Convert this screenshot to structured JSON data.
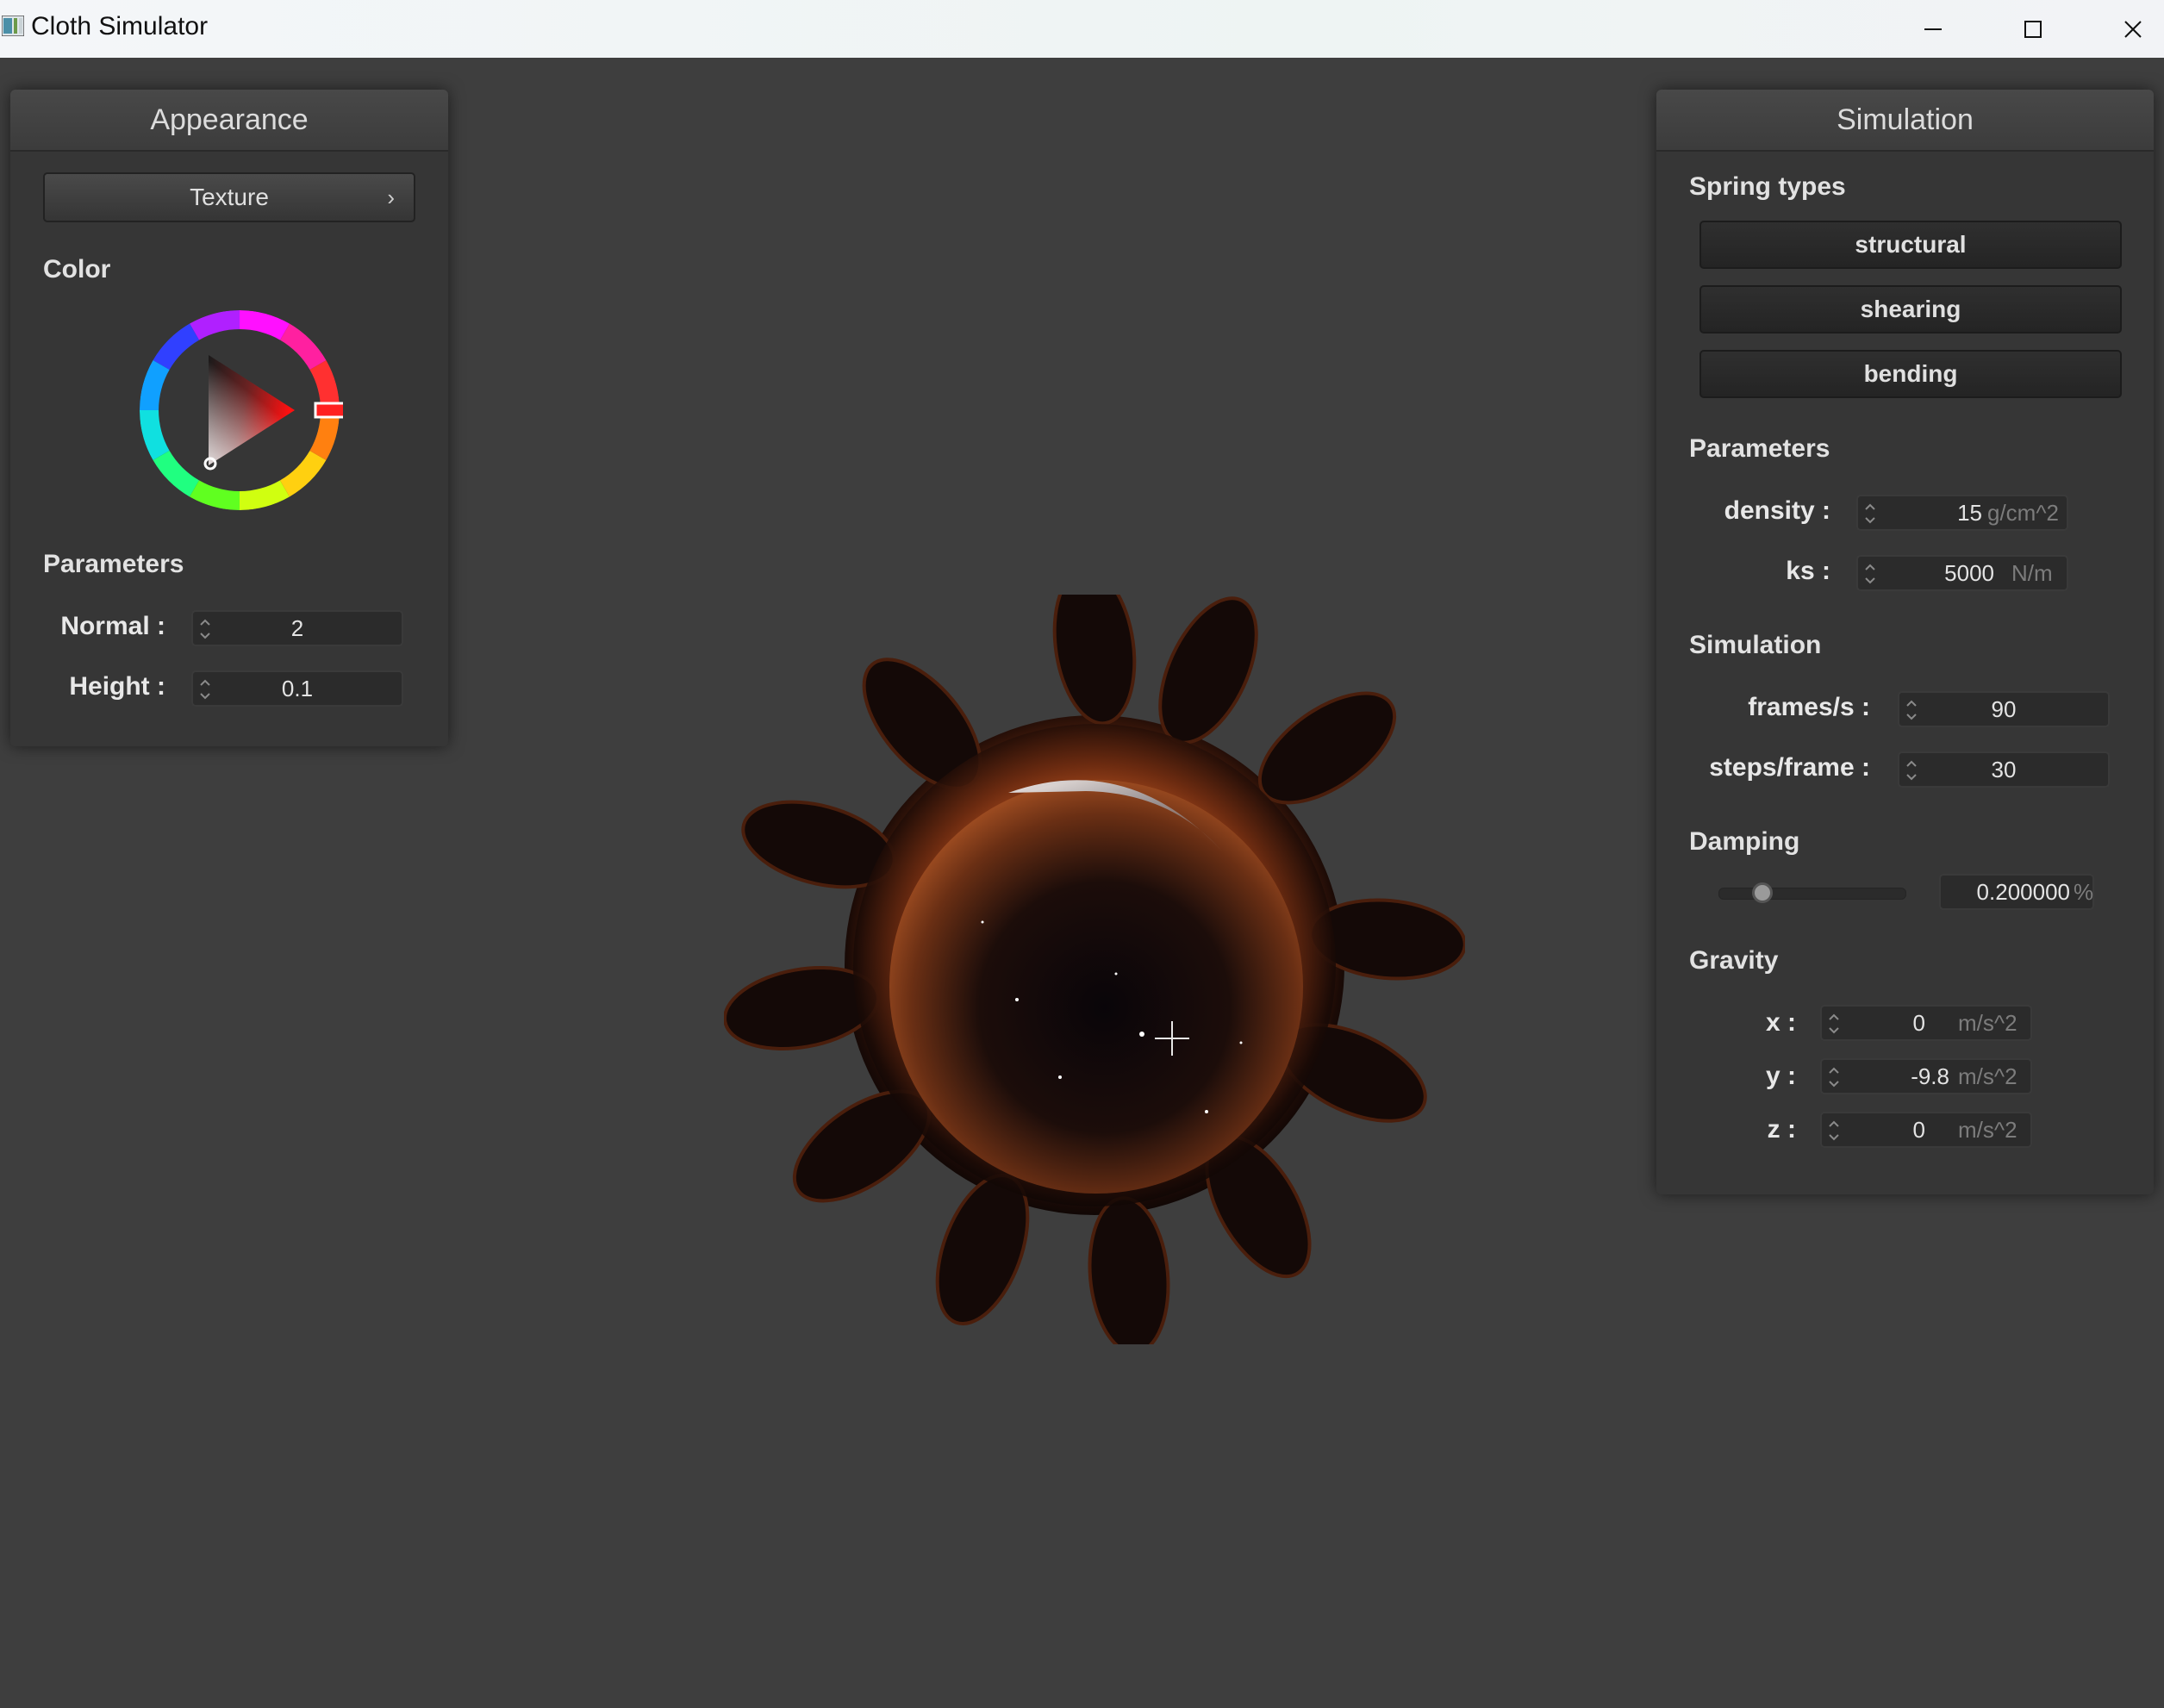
{
  "window": {
    "title": "Cloth Simulator",
    "icon": "app-icon",
    "controls": [
      "minimize-icon",
      "maximize-icon",
      "close-icon"
    ]
  },
  "appearance": {
    "header": "Appearance",
    "texture_button": "Texture",
    "color_label": "Color",
    "selected_color": "#ff0000",
    "parameters_label": "Parameters",
    "normal": {
      "label": "Normal :",
      "value": "2"
    },
    "height": {
      "label": "Height :",
      "value": "0.1"
    }
  },
  "simulation_panel": {
    "header": "Simulation",
    "spring_types": {
      "label": "Spring types",
      "buttons": [
        "structural",
        "shearing",
        "bending"
      ]
    },
    "parameters": {
      "label": "Parameters",
      "density": {
        "label": "density :",
        "value": "15",
        "unit": "g/cm^2"
      },
      "ks": {
        "label": "ks :",
        "value": "5000",
        "unit": "N/m"
      }
    },
    "simulation": {
      "label": "Simulation",
      "frames": {
        "label": "frames/s :",
        "value": "90"
      },
      "steps": {
        "label": "steps/frame :",
        "value": "30"
      }
    },
    "damping": {
      "label": "Damping",
      "value": "0.200000",
      "unit": "%",
      "slider_fraction": 0.2
    },
    "gravity": {
      "label": "Gravity",
      "x": {
        "label": "x :",
        "value": "0",
        "unit": "m/s^2"
      },
      "y": {
        "label": "y :",
        "value": "-9.8",
        "unit": "m/s^2"
      },
      "z": {
        "label": "z :",
        "value": "0",
        "unit": "m/s^2"
      }
    }
  },
  "colors": {
    "background": "#3e3e3e",
    "panel": "#363636",
    "cloth_orange": "#b5501f"
  }
}
